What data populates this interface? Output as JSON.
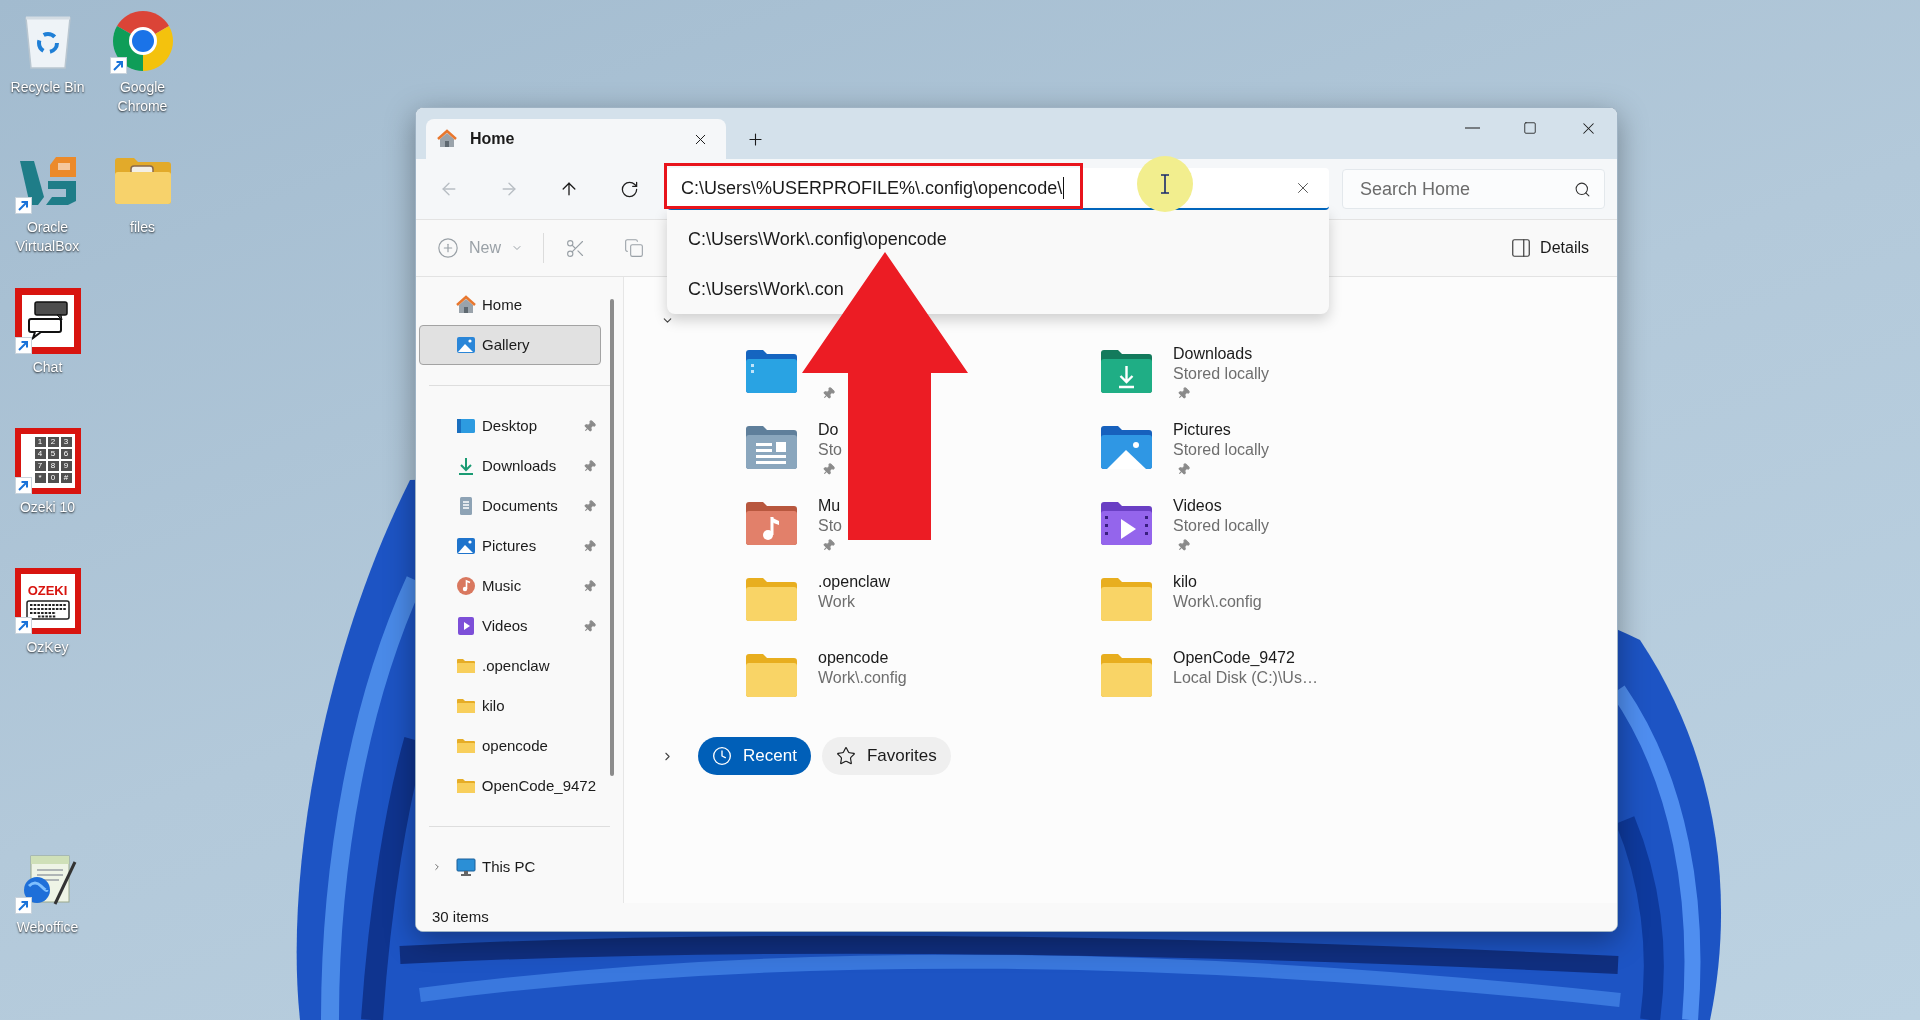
{
  "desktop_icons": [
    {
      "kind": "recycle_bin",
      "label": "Recycle Bin",
      "shortcut": false
    },
    {
      "kind": "chrome",
      "label": "Google Chrome",
      "shortcut": true
    },
    {
      "kind": "virtualbox",
      "label": "Oracle VirtualBox",
      "shortcut": true
    },
    {
      "kind": "folder",
      "label": "files",
      "shortcut": false
    },
    {
      "kind": "chat",
      "label": "Chat",
      "shortcut": true
    },
    {
      "kind": "keypad",
      "label": "Ozeki 10",
      "shortcut": true,
      "keys": [
        "1",
        "2",
        "3",
        "4",
        "5",
        "6",
        "7",
        "8",
        "9",
        "*",
        "0",
        "#"
      ]
    },
    {
      "kind": "keyboard",
      "label": "OzKey",
      "shortcut": true,
      "logo_text": "OZEKI"
    },
    {
      "kind": "weboffice",
      "label": "Weboffice",
      "shortcut": true
    }
  ],
  "window": {
    "tabs": [
      {
        "kind": "home",
        "title": "Home",
        "selected": true
      }
    ],
    "nav_buttons": [
      {
        "kind": "back",
        "disabled": true
      },
      {
        "kind": "forward",
        "disabled": true
      },
      {
        "kind": "up",
        "disabled": false
      },
      {
        "kind": "refresh",
        "disabled": false
      }
    ],
    "address_bar": {
      "value": "C:\\Users\\%USERPROFILE%\\.config\\opencode\\",
      "focused": true,
      "suggestions": [
        "C:\\Users\\Work\\.config\\opencode",
        "C:\\Users\\Work\\.con"
      ]
    },
    "search": {
      "placeholder": "Search Home"
    },
    "toolbar": {
      "buttons": [
        {
          "kind": "new",
          "label": "New",
          "disabled": true
        },
        {
          "kind": "cut",
          "disabled": true
        },
        {
          "kind": "copy",
          "disabled": true
        }
      ],
      "details": {
        "label": "Details"
      }
    },
    "sidebar": {
      "sections": [
        {
          "items": [
            {
              "kind": "home",
              "label": "Home",
              "selected": false
            },
            {
              "kind": "gallery",
              "label": "Gallery",
              "selected": true
            }
          ]
        },
        {
          "items": [
            {
              "kind": "desktop",
              "label": "Desktop",
              "pinned": true,
              "selected": false
            },
            {
              "kind": "downloads",
              "label": "Downloads",
              "pinned": true,
              "selected": false
            },
            {
              "kind": "documents",
              "label": "Documents",
              "pinned": true,
              "selected": false
            },
            {
              "kind": "pictures",
              "label": "Pictures",
              "pinned": true,
              "selected": false
            },
            {
              "kind": "music",
              "label": "Music",
              "pinned": true,
              "selected": false
            },
            {
              "kind": "videos",
              "label": "Videos",
              "pinned": true,
              "selected": false
            },
            {
              "kind": "folder",
              "label": ".openclaw",
              "pinned": false,
              "selected": false
            },
            {
              "kind": "folder",
              "label": "kilo",
              "pinned": false,
              "selected": false
            },
            {
              "kind": "folder",
              "label": "opencode",
              "pinned": false,
              "selected": false
            },
            {
              "kind": "folder",
              "label": "OpenCode_9472",
              "pinned": false,
              "selected": false
            }
          ]
        },
        {
          "items": [
            {
              "kind": "this_pc",
              "label": "This PC",
              "selected": false,
              "expanded": false
            }
          ]
        }
      ]
    },
    "quick_access": {
      "expanded": true,
      "items": [
        {
          "kind": "desktop",
          "pinned": true
        },
        {
          "kind": "downloads",
          "name": "Downloads",
          "location": "Stored locally",
          "pinned": true
        },
        {
          "kind": "documents",
          "name": "Do",
          "location": "Sto",
          "pinned": true
        },
        {
          "kind": "pictures",
          "name": "Pictures",
          "location": "Stored locally",
          "pinned": true
        },
        {
          "kind": "music",
          "name": "Mu",
          "location": "Sto",
          "pinned": true
        },
        {
          "kind": "videos",
          "name": "Videos",
          "location": "Stored locally",
          "pinned": true
        },
        {
          "kind": "folder",
          "name": ".openclaw",
          "location": "Work",
          "pinned": false
        },
        {
          "kind": "folder",
          "name": "kilo",
          "location": "Work\\.config",
          "pinned": false
        },
        {
          "kind": "folder",
          "name": "opencode",
          "location": "Work\\.config",
          "pinned": false
        },
        {
          "kind": "folder",
          "name": "OpenCode_9472",
          "location": "Local Disk (C:)\\Us…",
          "pinned": false
        }
      ]
    },
    "recent_sections": {
      "expanded": false,
      "tabs": [
        {
          "kind": "clock",
          "label": "Recent",
          "selected": true
        },
        {
          "kind": "star",
          "label": "Favorites",
          "selected": false
        }
      ]
    },
    "status_bar": {
      "item_count": "30 items"
    }
  },
  "annotations": [
    {
      "kind": "address_highlight"
    },
    {
      "kind": "arrow"
    },
    {
      "kind": "cursor_spot"
    }
  ]
}
